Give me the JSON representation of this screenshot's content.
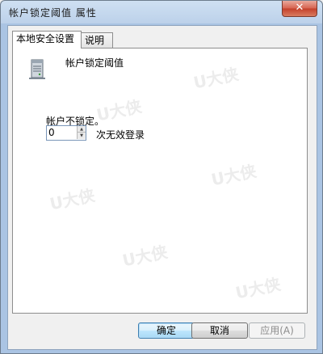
{
  "window": {
    "title": "帐户锁定阈值 属性",
    "close_glyph": "✕"
  },
  "tabs": [
    {
      "label": "本地安全设置",
      "active": true
    },
    {
      "label": "说明",
      "active": false
    }
  ],
  "policy": {
    "icon": "server-icon",
    "title": "帐户锁定阈值"
  },
  "setting": {
    "label": "帐户不锁定。",
    "value": "0",
    "suffix": "次无效登录"
  },
  "buttons": {
    "ok": "确定",
    "cancel": "取消",
    "apply": "应用(A)"
  },
  "watermark": {
    "text": "U大侠"
  }
}
